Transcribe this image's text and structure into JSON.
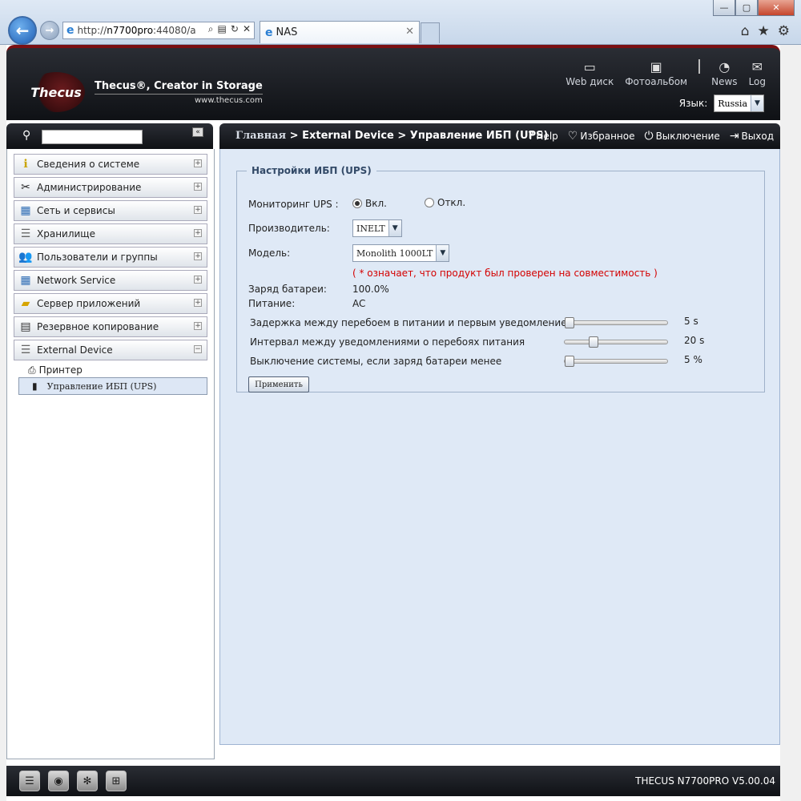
{
  "browser": {
    "url_prefix": "http://",
    "url_host": "n7700pro",
    "url_rest": ":44080/a",
    "tab_title": "NAS"
  },
  "header": {
    "logo_mark": "Thecus",
    "tagline": "Thecus®, Creator in Storage",
    "site": "www.thecus.com",
    "tools": [
      {
        "label": "Web диск",
        "icon": "hard-drive-icon"
      },
      {
        "label": "Фотоальбом",
        "icon": "photo-icon"
      },
      {
        "label": "News",
        "icon": "rss-icon"
      },
      {
        "label": "Log",
        "icon": "speech-icon"
      }
    ],
    "language_label": "Язык:",
    "language_value": "Russia"
  },
  "breadcrumb": {
    "home": "Главная",
    "path": " > External Device > Управление ИБП (UPS)",
    "help": "Help",
    "favorites": "Избранное",
    "shutdown": "Выключение",
    "logout": "Выход"
  },
  "sidebar": {
    "items": [
      {
        "label": "Сведения о системе",
        "icon": "info-icon"
      },
      {
        "label": "Администрирование",
        "icon": "tools-icon"
      },
      {
        "label": "Сеть и сервисы",
        "icon": "network-icon"
      },
      {
        "label": "Хранилище",
        "icon": "storage-icon"
      },
      {
        "label": "Пользователи и группы",
        "icon": "users-icon"
      },
      {
        "label": "Network Service",
        "icon": "network-service-icon"
      },
      {
        "label": "Сервер приложений",
        "icon": "folder-icon"
      },
      {
        "label": "Резервное копирование",
        "icon": "backup-icon"
      },
      {
        "label": "External Device",
        "icon": "external-device-icon"
      }
    ],
    "sub_items": [
      {
        "label": "Принтер",
        "icon": "printer-icon"
      },
      {
        "label": "Управление ИБП (UPS)",
        "icon": "ups-icon"
      }
    ]
  },
  "ups": {
    "legend": "Настройки ИБП (UPS)",
    "monitoring_label": "Мониторинг UPS :",
    "on_label": "Вкл.",
    "off_label": "Откл.",
    "monitoring_state": "on",
    "vendor_label": "Производитель:",
    "vendor_value": "INELT",
    "model_label": "Модель:",
    "model_value": "Monolith 1000LT",
    "compat_note": "( * означает, что продукт был проверен на совместимость )",
    "battery_label": "Заряд батареи:",
    "battery_value": "100.0%",
    "power_label": "Питание:",
    "power_value": "AC",
    "sliders": [
      {
        "label": "Задержка между перебоем в питании и первым уведомлением",
        "value": "5 s",
        "level": 0.0
      },
      {
        "label": "Интервал между уведомлениями о перебоях питания",
        "value": "20 s",
        "level": 0.25
      },
      {
        "label": "Выключение системы, если заряд батареи менее",
        "value": "5 %",
        "level": 0.0
      }
    ],
    "apply_label": "Применить"
  },
  "footer": {
    "version": "THECUS N7700PRO V5.00.04",
    "icons": [
      "server-icon",
      "disk-icon",
      "fan-icon",
      "lan-icon"
    ]
  }
}
